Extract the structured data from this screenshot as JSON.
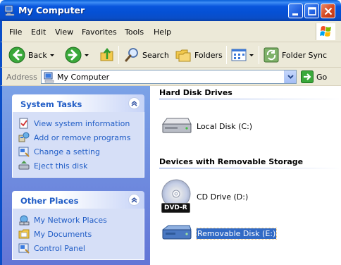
{
  "window": {
    "title": "My Computer"
  },
  "menu": [
    "File",
    "Edit",
    "View",
    "Favorites",
    "Tools",
    "Help"
  ],
  "toolbar": {
    "back_label": "Back",
    "search_label": "Search",
    "folders_label": "Folders",
    "folder_sync_label": "Folder Sync"
  },
  "address": {
    "label": "Address",
    "value": "My Computer",
    "go_label": "Go"
  },
  "system_tasks": {
    "title": "System Tasks",
    "items": [
      "View system information",
      "Add or remove programs",
      "Change a setting",
      "Eject this disk"
    ]
  },
  "other_places": {
    "title": "Other Places",
    "items": [
      "My Network Places",
      "My Documents",
      "Control Panel"
    ]
  },
  "groups": {
    "hard_disks": {
      "title": "Hard Disk Drives",
      "items": [
        "Local Disk (C:)"
      ]
    },
    "removable": {
      "title": "Devices with Removable Storage",
      "items": [
        "CD Drive (D:)",
        "Removable Disk (E:)"
      ],
      "dvd_badge": "DVD-R"
    }
  },
  "colors": {
    "titlebar": "#0a5fd8",
    "taskpane_link": "#215dc6",
    "selection": "#316ac5",
    "chrome": "#ece9d8"
  }
}
